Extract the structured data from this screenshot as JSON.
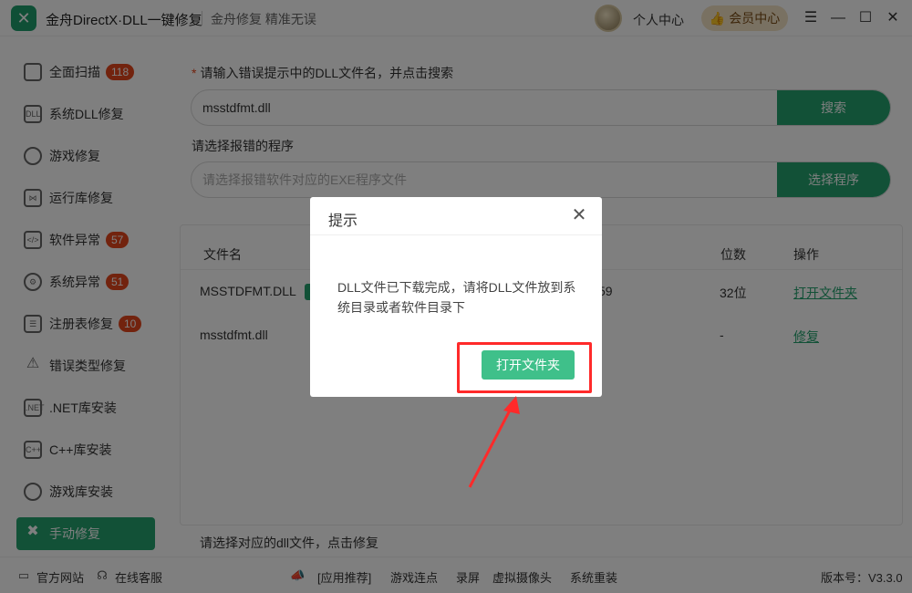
{
  "title_bar": {
    "app_title": "金舟DirectX·DLL一键修复",
    "slogan": "金舟修复 精准无误",
    "personal_center": "个人中心",
    "vip_center": "会员中心",
    "window_controls": [
      "menu-icon",
      "minimize-icon",
      "maximize-icon",
      "close-icon"
    ]
  },
  "sidebar": {
    "items": [
      {
        "label": "全面扫描",
        "badge": "118",
        "icon": "scan-icon"
      },
      {
        "label": "系统DLL修复",
        "badge": "",
        "icon": "dll-icon"
      },
      {
        "label": "游戏修复",
        "badge": "",
        "icon": "gamepad-icon"
      },
      {
        "label": "运行库修复",
        "badge": "",
        "icon": "vs-icon"
      },
      {
        "label": "软件异常",
        "badge": "57",
        "icon": "code-icon"
      },
      {
        "label": "系统异常",
        "badge": "51",
        "icon": "gear-icon"
      },
      {
        "label": "注册表修复",
        "badge": "10",
        "icon": "registry-icon"
      },
      {
        "label": "错误类型修复",
        "badge": "",
        "icon": "warning-icon"
      },
      {
        "label": ".NET库安装",
        "badge": "",
        "icon": "dotnet-icon"
      },
      {
        "label": "C++库安装",
        "badge": "",
        "icon": "cpp-icon"
      },
      {
        "label": "游戏库安装",
        "badge": "",
        "icon": "pacman-icon"
      },
      {
        "label": "手动修复",
        "badge": "",
        "icon": "tools-icon",
        "active": true
      }
    ]
  },
  "main": {
    "dll_prompt": "请输入错误提示中的DLL文件名，并点击搜索",
    "dll_input_value": "msstdfmt.dll",
    "search_button": "搜索",
    "program_prompt": "请选择报错的程序",
    "program_placeholder": "请选择报错软件对应的EXE程序文件",
    "select_program_button": "选择程序",
    "table": {
      "headers": [
        "文件名",
        "位数",
        "操作"
      ],
      "rows": [
        {
          "filename": "MSSTDFMT.DLL",
          "partial": "59",
          "bits": "32位",
          "action": "打开文件夹"
        },
        {
          "filename": "msstdfmt.dll",
          "partial": "",
          "bits": "-",
          "action": "修复"
        }
      ]
    },
    "hint": "请选择对应的dll文件，点击修复"
  },
  "status_bar": {
    "official_site": "官方网站",
    "online_service": "在线客服",
    "recommend": "[应用推荐]",
    "links": [
      "游戏连点",
      "录屏",
      "虚拟摄像头",
      "系统重装"
    ],
    "version": "版本号：V3.3.0"
  },
  "dialog": {
    "title": "提示",
    "message": "DLL文件已下载完成，请将DLL文件放到系统目录或者软件目录下",
    "button": "打开文件夹"
  },
  "colors": {
    "accent": "#24a36f",
    "badge": "#e5471d",
    "highlight": "#ff2a2a",
    "dialog_button": "#3fc08a"
  }
}
